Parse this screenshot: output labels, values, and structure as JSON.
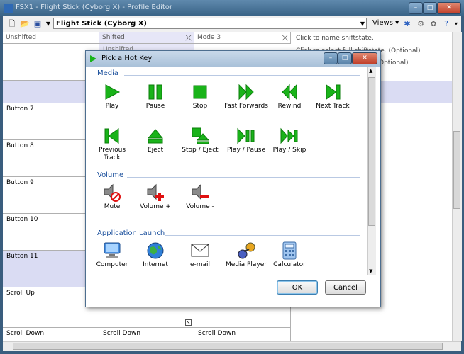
{
  "window": {
    "title": "FSX1 - Flight Stick (Cyborg X) - Profile Editor"
  },
  "toolbar": {
    "profile": "Flight Stick (Cyborg X)",
    "views_label": "Views"
  },
  "columns": [
    {
      "label": "Unshifted"
    },
    {
      "label": "Shifted"
    },
    {
      "label": "Mode 3"
    }
  ],
  "side_texts": [
    "Click to name shiftstate.",
    "Click to select full shiftstate. (Optional)",
    "Optional)"
  ],
  "rows": [
    {
      "label": "Button 7"
    },
    {
      "label": "Button 8"
    },
    {
      "label": "Button 9"
    },
    {
      "label": "Button 10"
    },
    {
      "label": "Button 11"
    },
    {
      "label": "Scroll Up"
    },
    {
      "label": "Scroll Down"
    }
  ],
  "scroll_down_cells": [
    "Scroll Down",
    "Scroll Down",
    "Scroll Down"
  ],
  "shifted_partial": "Unshifted",
  "dialog": {
    "title": "Pick a Hot Key",
    "sections": {
      "media": "Media",
      "volume": "Volume",
      "app": "Application Launch"
    },
    "media_items": [
      "Play",
      "Pause",
      "Stop",
      "Fast Forwards",
      "Rewind",
      "Next Track",
      "Previous Track",
      "Eject",
      "Stop / Eject",
      "Play / Pause",
      "Play / Skip"
    ],
    "volume_items": [
      "Mute",
      "Volume +",
      "Volume -"
    ],
    "app_items": [
      "Computer",
      "Internet",
      "e-mail",
      "Media Player",
      "Calculator"
    ],
    "ok": "OK",
    "cancel": "Cancel"
  },
  "colors": {
    "accent_green": "#19b319",
    "selection_lavender": "#dadcf3"
  }
}
